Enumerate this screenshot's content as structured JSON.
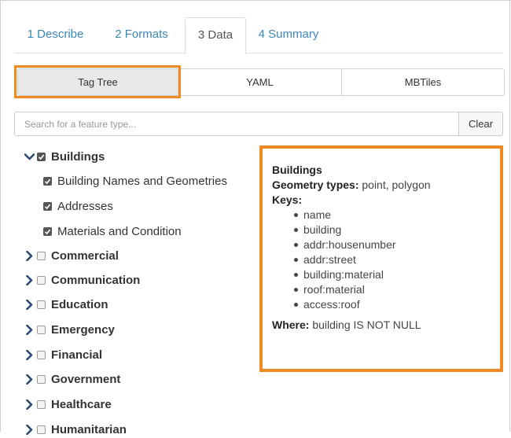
{
  "tabs": [
    {
      "label": "1 Describe"
    },
    {
      "label": "2 Formats"
    },
    {
      "label": "3 Data"
    },
    {
      "label": "4 Summary"
    }
  ],
  "modes": [
    {
      "label": "Tag Tree"
    },
    {
      "label": "YAML"
    },
    {
      "label": "MBTiles"
    }
  ],
  "search": {
    "placeholder": "Search for a feature type...",
    "value": "",
    "clear_label": "Clear"
  },
  "tree": {
    "root": {
      "label": "Buildings"
    },
    "children": [
      {
        "label": "Building Names and Geometries"
      },
      {
        "label": "Addresses"
      },
      {
        "label": "Materials and Condition"
      }
    ],
    "collapsed": [
      {
        "label": "Commercial"
      },
      {
        "label": "Communication"
      },
      {
        "label": "Education"
      },
      {
        "label": "Emergency"
      },
      {
        "label": "Financial"
      },
      {
        "label": "Government"
      },
      {
        "label": "Healthcare"
      },
      {
        "label": "Humanitarian"
      }
    ]
  },
  "info": {
    "title": "Buildings",
    "geometry_label": "Geometry types:",
    "geometry_value": "point, polygon",
    "keys_label": "Keys:",
    "keys": [
      "name",
      "building",
      "addr:housenumber",
      "addr:street",
      "building:material",
      "roof:material",
      "access:roof"
    ],
    "where_label": "Where:",
    "where_value": "building IS NOT NULL"
  },
  "colors": {
    "highlight": "#ee8a21",
    "tab_link": "#3b86b8",
    "active_mode": "#e8e8e8"
  }
}
